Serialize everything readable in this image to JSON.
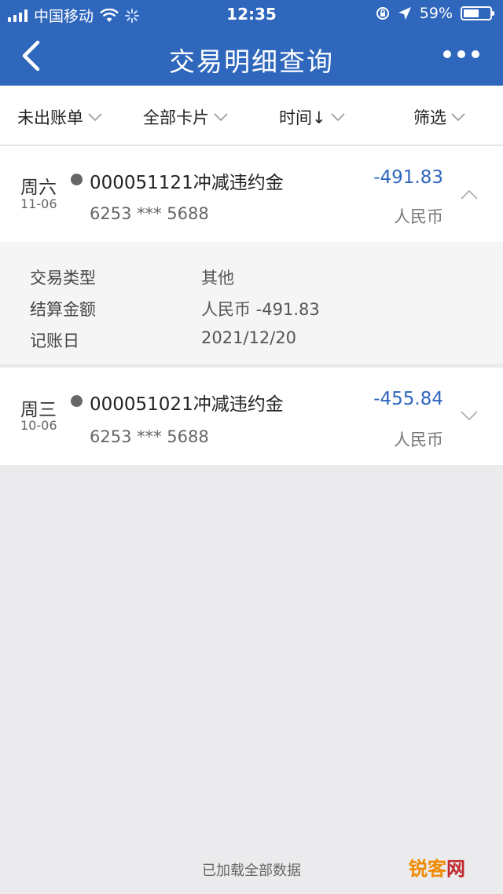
{
  "status_bar": {
    "carrier": "中国移动",
    "time": "12:35",
    "battery": "59%",
    "battery_level": 0.59
  },
  "nav": {
    "title": "交易明细查询",
    "back_icon": "back-chevron-icon",
    "more_icon": "more-dots-icon"
  },
  "filters": [
    {
      "label": "未出账单"
    },
    {
      "label": "全部卡片"
    },
    {
      "label": "时间↓"
    },
    {
      "label": "筛选"
    }
  ],
  "transactions": [
    {
      "day": "周六",
      "date": "11-06",
      "description": "000051121冲减违约金",
      "card": "6253 *** 5688",
      "amount": "-491.83",
      "currency": "人民币",
      "expanded": true
    },
    {
      "day": "周三",
      "date": "10-06",
      "description": "000051021冲减违约金",
      "card": "6253 *** 5688",
      "amount": "-455.84",
      "currency": "人民币",
      "expanded": false
    }
  ],
  "detail": {
    "rows": [
      {
        "key": "交易类型",
        "value": "其他"
      },
      {
        "key": "结算金额",
        "value": "人民币 -491.83"
      },
      {
        "key": "记账日",
        "value": "2021/12/20"
      }
    ]
  },
  "footer": {
    "text": "已加载全部数据"
  },
  "watermark": {
    "part1": "锐客",
    "part2": "网"
  },
  "colors": {
    "brand_blue": "#2f67bd",
    "amount_color": "#2f67bd",
    "watermark_orange": "#f08a00",
    "watermark_red": "#c0282e"
  }
}
